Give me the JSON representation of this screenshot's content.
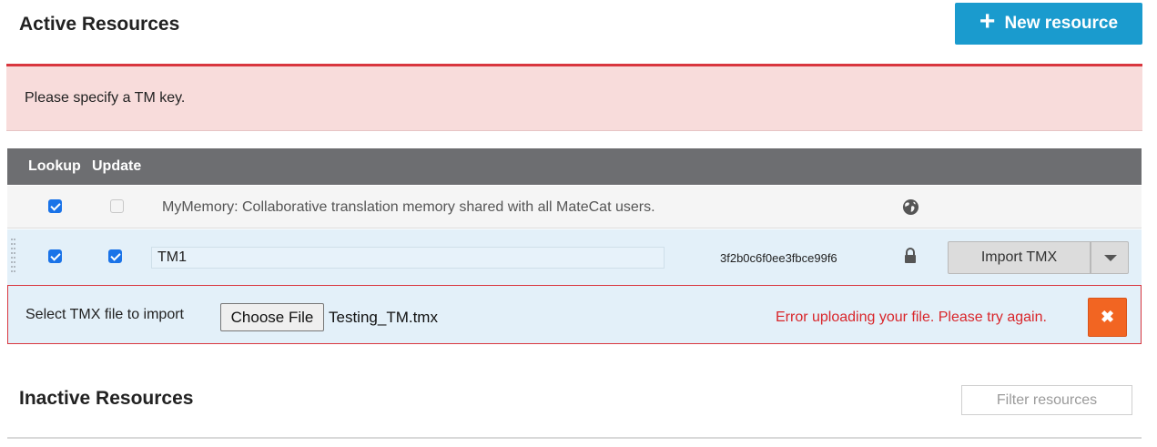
{
  "header": {
    "active_title": "Active Resources",
    "new_resource_label": "New resource",
    "new_resource_icon": "plus-icon"
  },
  "alert": {
    "message": "Please specify a TM key."
  },
  "table": {
    "columns": {
      "lookup": "Lookup",
      "update": "Update"
    },
    "rows": [
      {
        "name": "MyMemory: Collaborative translation memory shared with all MateCat users.",
        "lookup_checked": true,
        "update_checked": false,
        "update_disabled": true,
        "icon": "globe-icon"
      },
      {
        "name": "TM1",
        "key": "3f2b0c6f0ee3fbce99f6",
        "lookup_checked": true,
        "update_checked": true,
        "icon": "lock-icon",
        "import_label": "Import TMX"
      }
    ]
  },
  "import_panel": {
    "label": "Select TMX file to import",
    "choose_file_label": "Choose File",
    "file_name": "Testing_TM.tmx",
    "error": "Error uploading your file. Please try again.",
    "close_icon": "close-icon",
    "close_glyph": "✖"
  },
  "inactive": {
    "title": "Inactive Resources",
    "filter_placeholder": "Filter resources"
  },
  "colors": {
    "accent": "#1a9bce",
    "alert_bg": "#f8dcdb",
    "alert_border": "#d9363e",
    "header_bg": "#6d6e71",
    "error_text": "#d9262b",
    "close_button": "#f26522"
  }
}
